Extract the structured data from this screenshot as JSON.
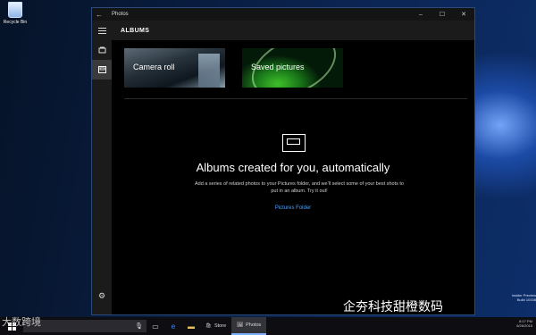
{
  "desktop": {
    "recycle_bin_label": "Recycle Bin",
    "clock_lines": [
      "Insider Preview",
      "Build 10158",
      "8:17 PM",
      "6/26/2015"
    ]
  },
  "window": {
    "title": "Photos",
    "controls": {
      "minimize": "–",
      "maximize": "☐",
      "close": "✕"
    },
    "back_glyph": "←"
  },
  "rail": {
    "icons": [
      "hamburger-icon",
      "collection-icon",
      "albums-icon",
      "gear-icon"
    ]
  },
  "header": {
    "title": "ALBUMS"
  },
  "tiles": [
    {
      "label": "Camera roll"
    },
    {
      "label": "Saved pictures"
    }
  ],
  "empty_state": {
    "headline": "Albums created for you, automatically",
    "description": "Add a series of related photos to your Pictures folder, and we'll select some of your best shots to put in an album. Try it out!",
    "link": "Pictures Folder"
  },
  "taskbar": {
    "apps": [
      {
        "label": "Store"
      },
      {
        "label": "Photos"
      }
    ]
  },
  "watermarks": {
    "left": "大数跨境",
    "right": "企夯科技甜橙数码"
  }
}
